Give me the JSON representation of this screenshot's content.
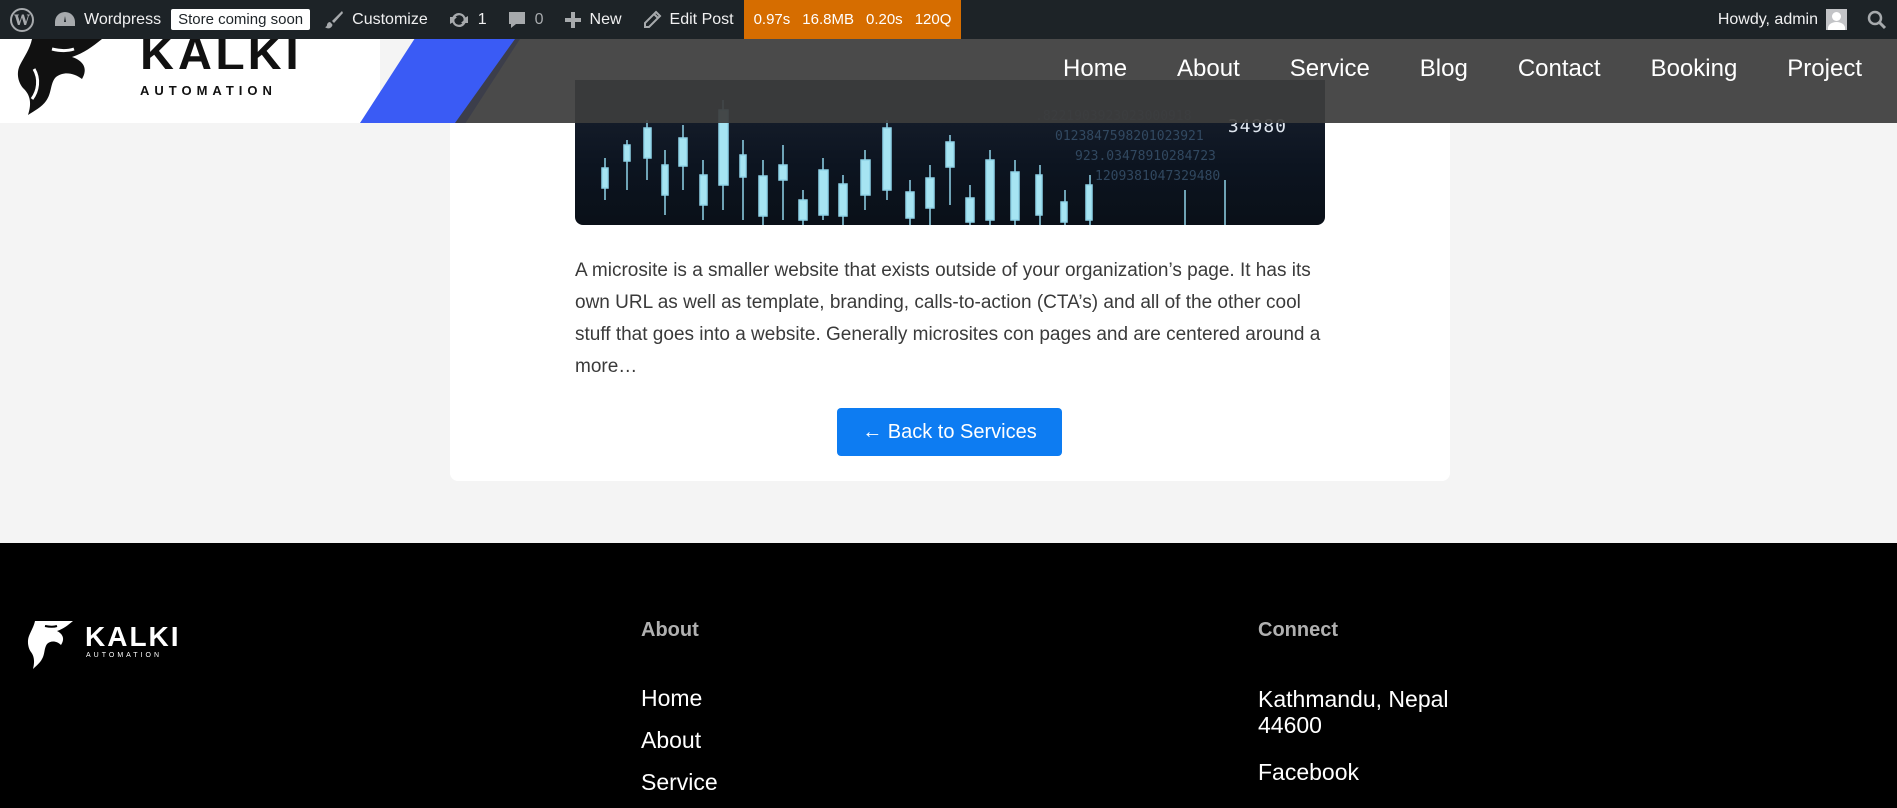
{
  "adminbar": {
    "site_name": "Wordpress",
    "store_badge": "Store coming soon",
    "customize": "Customize",
    "updates_count": "1",
    "comments_count": "0",
    "new_label": "New",
    "edit_post": "Edit Post",
    "qm_time": "0.97s",
    "qm_memory": "16.8MB",
    "qm_db_time": "0.20s",
    "qm_queries": "120Q",
    "howdy": "Howdy, admin"
  },
  "header": {
    "logo_title": "KALKI",
    "logo_sub": "AUTOMATION",
    "nav": [
      "Home",
      "About",
      "Service",
      "Blog",
      "Contact",
      "Booking",
      "Project"
    ]
  },
  "main": {
    "hero_number": "34980",
    "description": "A microsite is a smaller website that exists outside of your organization’s page. It has its own URL as well as template, branding, calls-to-action (CTA’s) and all of the other cool stuff that goes into a website. Generally microsites con pages and are centered around a more…",
    "back_button": "← Back to Services"
  },
  "footer": {
    "logo_title": "KALKI",
    "logo_sub": "AUTOMATION",
    "about_heading": "About",
    "about_links": [
      "Home",
      "About",
      "Service"
    ],
    "connect_heading": "Connect",
    "address_line1": "Kathmandu, Nepal",
    "address_line2": "44600",
    "facebook": "Facebook"
  },
  "colors": {
    "adminbar_bg": "#1d2327",
    "query_monitor_bg": "#d66d00",
    "accent_blue": "#3a5bf5",
    "button_blue": "#0d7cf2",
    "footer_bg": "#000000"
  },
  "icons": [
    "wordpress-icon",
    "dashboard-icon",
    "brush-icon",
    "update-icon",
    "comment-icon",
    "plus-icon",
    "pencil-icon",
    "search-icon",
    "avatar"
  ]
}
